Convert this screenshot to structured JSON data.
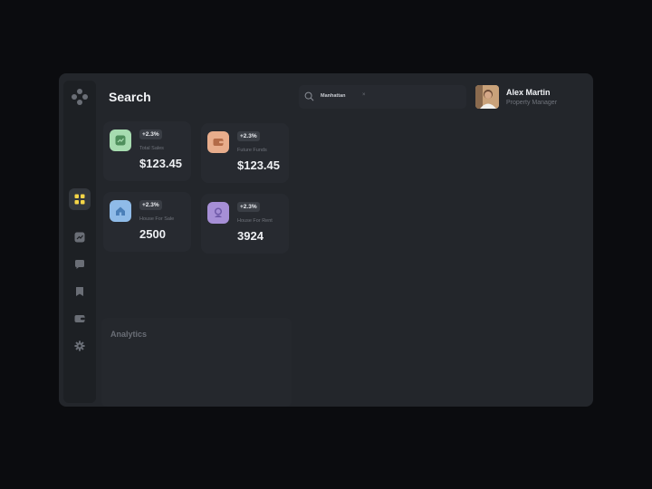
{
  "header": {
    "title": "Search"
  },
  "search": {
    "query": "Manhattan",
    "clear_glyph": "×"
  },
  "profile": {
    "name": "Alex Martin",
    "role": "Property Manager"
  },
  "cards": [
    {
      "badge": "+2.3%",
      "label": "Total Sales",
      "value": "$123.45",
      "icon": "chart-icon",
      "tile_color": "#a7dcb0",
      "glyph_color": "#4f8f5c"
    },
    {
      "badge": "+2.3%",
      "label": "Future Funds",
      "value": "$123.45",
      "icon": "wallet-icon",
      "tile_color": "#e8ad8c",
      "glyph_color": "#b36b48"
    },
    {
      "badge": "+2.3%",
      "label": "House For Sale",
      "value": "2500",
      "icon": "house-icon",
      "tile_color": "#8fbbe8",
      "glyph_color": "#4a7fb8"
    },
    {
      "badge": "+2.3%",
      "label": "House For Rent",
      "value": "3924",
      "icon": "key-icon",
      "tile_color": "#a68fd6",
      "glyph_color": "#6f5aa8"
    }
  ],
  "analytics": {
    "title": "Analytics"
  },
  "sidebar": {
    "items": [
      {
        "icon": "dashboard-icon",
        "active": true
      },
      {
        "icon": "chart-icon",
        "active": false
      },
      {
        "icon": "message-icon",
        "active": false
      },
      {
        "icon": "bookmark-icon",
        "active": false
      },
      {
        "icon": "wallet-icon",
        "active": false
      },
      {
        "icon": "settings-icon",
        "active": false
      }
    ]
  },
  "colors": {
    "accent": "#f5d547",
    "panel": "#23262b",
    "card": "#272a30"
  }
}
